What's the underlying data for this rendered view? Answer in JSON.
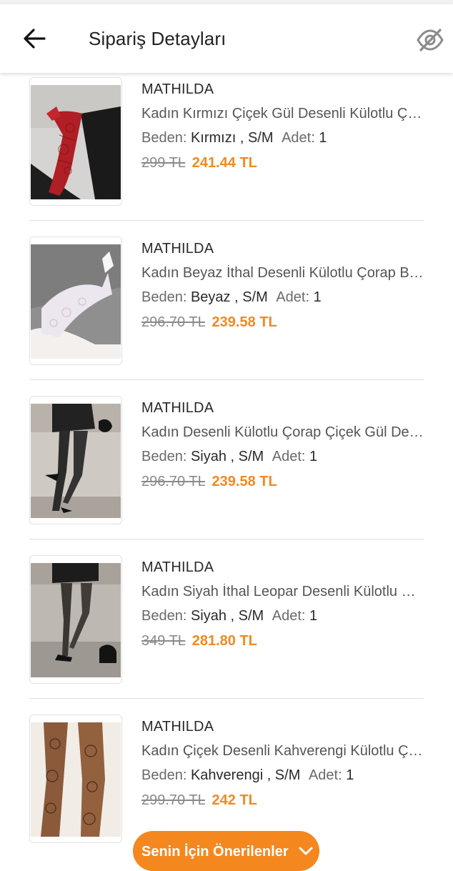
{
  "header": {
    "title": "Sipariş Detayları",
    "back_icon": "arrow-left-icon",
    "hide_icon": "eye-off-icon"
  },
  "labels": {
    "size": "Beden:",
    "quantity": "Adet:"
  },
  "items": [
    {
      "brand": "MATHILDA",
      "name": "Kadın Kırmızı Çiçek Gül Desenli Külotlu Çorap",
      "color_size": "Kırmızı , S/M",
      "quantity": "1",
      "old_price": "299 TL",
      "price": "241.44 TL"
    },
    {
      "brand": "MATHILDA",
      "name": "Kadın Beyaz İthal Desenli Külotlu Çorap Beyaz",
      "color_size": "Beyaz , S/M",
      "quantity": "1",
      "old_price": "296.70 TL",
      "price": "239.58 TL"
    },
    {
      "brand": "MATHILDA",
      "name": "Kadın Desenli Külotlu Çorap Çiçek Gül Desenli",
      "color_size": "Siyah , S/M",
      "quantity": "1",
      "old_price": "296.70 TL",
      "price": "239.58 TL"
    },
    {
      "brand": "MATHILDA",
      "name": "Kadın Siyah İthal Leopar Desenli Külotlu Çorap",
      "color_size": "Siyah , S/M",
      "quantity": "1",
      "old_price": "349 TL",
      "price": "281.80 TL"
    },
    {
      "brand": "MATHILDA",
      "name": "Kadın Çiçek Desenli Kahverengi Külotlu Çorap",
      "color_size": "Kahverengi , S/M",
      "quantity": "1",
      "old_price": "299.70 TL",
      "price": "242 TL"
    }
  ],
  "recommendations_button": "Senin İçin Önerilenler",
  "colors": {
    "accent": "#f5871f",
    "price": "#f08a24"
  }
}
